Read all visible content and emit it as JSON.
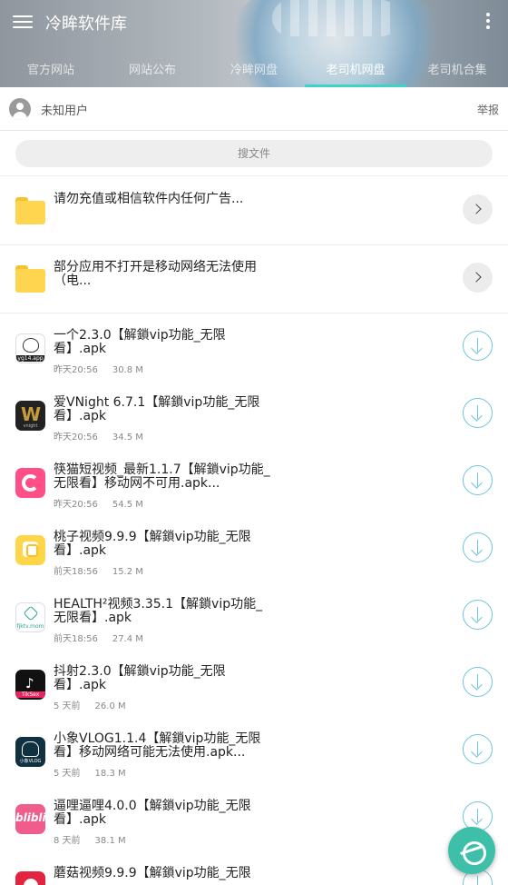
{
  "header": {
    "title": "冷眸软件库",
    "menu_icon": "menu-icon",
    "more_icon": "more-vert-icon"
  },
  "tabs": [
    {
      "label": "官方网站",
      "active": false
    },
    {
      "label": "网站公布",
      "active": false
    },
    {
      "label": "冷眸网盘",
      "active": false
    },
    {
      "label": "老司机网盘",
      "active": true
    },
    {
      "label": "老司机合集",
      "active": false
    }
  ],
  "user": {
    "name": "未知用户",
    "report_label": "举报"
  },
  "search": {
    "placeholder": "搜文件"
  },
  "folders": [
    {
      "title": "请勿充值或相信软件内任何广告..."
    },
    {
      "title": "部分应用不打开是移动网络无法使用（电..."
    }
  ],
  "files": [
    {
      "title": "一个2.3.0【解鎖vip功能_无限看】.apk",
      "time": "昨天20:56",
      "size": "30.8 M",
      "icon_text": "yg14.app"
    },
    {
      "title": "爱VNight 6.7.1【解鎖vip功能_无限看】.apk",
      "time": "昨天20:56",
      "size": "34.5 M",
      "icon_text": "W"
    },
    {
      "title": "筷猫短视频_最新1.1.7【解鎖vip功能_无限看】移动网不可用.apk...",
      "time": "昨天20:56",
      "size": "54.5 M",
      "icon_text": ""
    },
    {
      "title": "桃子视频9.9.9【解鎖vip功能_无限看】.apk",
      "time": "前天18:56",
      "size": "15.2 M",
      "icon_text": ""
    },
    {
      "title": "HEALTH²视频3.35.1【解鎖vip功能_无限看】.apk",
      "time": "前天18:56",
      "size": "27.4 M",
      "icon_text": "fjktv.mom"
    },
    {
      "title": "抖射2.3.0【解鎖vip功能_无限看】.apk",
      "time": "5 天前",
      "size": "26.0 M",
      "icon_text": "TikSex"
    },
    {
      "title": "小象VLOG1.1.4【解鎖vip功能_无限看】移动网络可能无法使用.apk...",
      "time": "5 天前",
      "size": "18.3 M",
      "icon_text": "小象VLOG"
    },
    {
      "title": "逼哩逼哩4.0.0【解鎖vip功能_无限看】.apk",
      "time": "8 天前",
      "size": "38.1 M",
      "icon_text": "blibli"
    },
    {
      "title": "蘑菇视频9.9.9【解鎖vip功能_无限",
      "time": "",
      "size": "",
      "icon_text": ""
    }
  ],
  "colors": {
    "accent": "#3fd3c4",
    "download": "#6fc4dd",
    "fab": "#3dbfa9",
    "folder": "#ffd54f"
  }
}
